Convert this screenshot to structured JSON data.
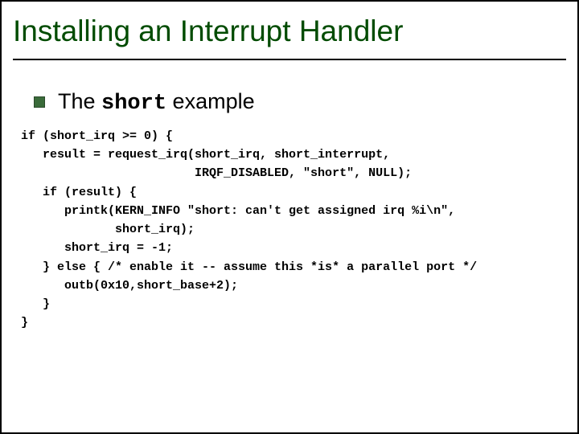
{
  "title": "Installing an Interrupt Handler",
  "bullet": {
    "prefix": "The ",
    "mono": "short",
    "suffix": " example"
  },
  "code_lines": [
    "if (short_irq >= 0) {",
    "   result = request_irq(short_irq, short_interrupt,",
    "                        IRQF_DISABLED, \"short\", NULL);",
    "   if (result) {",
    "      printk(KERN_INFO \"short: can't get assigned irq %i\\n\",",
    "             short_irq);",
    "      short_irq = -1;",
    "   } else { /* enable it -- assume this *is* a parallel port */",
    "      outb(0x10,short_base+2);",
    "   }",
    "}"
  ]
}
